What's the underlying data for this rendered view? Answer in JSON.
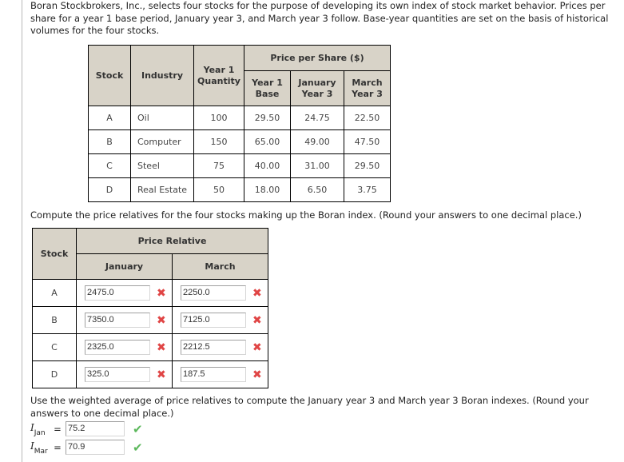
{
  "intro_text": "Boran Stockbrokers, Inc., selects four stocks for the purpose of developing its own index of stock market behavior. Prices per share for a year 1 base period, January year 3, and March year 3 follow. Base-year quantities are set on the basis of historical volumes for the four stocks.",
  "stock_table": {
    "headers": {
      "stock": "Stock",
      "industry": "Industry",
      "quantity_line1": "Year 1",
      "quantity_line2": "Quantity",
      "price_group": "Price per Share ($)",
      "base_line1": "Year 1",
      "base_line2": "Base",
      "jan_line1": "January",
      "jan_line2": "Year 3",
      "mar_line1": "March",
      "mar_line2": "Year 3"
    },
    "rows": [
      {
        "stock": "A",
        "industry": "Oil",
        "quantity": "100",
        "base": "29.50",
        "jan": "24.75",
        "mar": "22.50"
      },
      {
        "stock": "B",
        "industry": "Computer",
        "quantity": "150",
        "base": "65.00",
        "jan": "49.00",
        "mar": "47.50"
      },
      {
        "stock": "C",
        "industry": "Steel",
        "quantity": "75",
        "base": "40.00",
        "jan": "31.00",
        "mar": "29.50"
      },
      {
        "stock": "D",
        "industry": "Real Estate",
        "quantity": "50",
        "base": "18.00",
        "jan": "6.50",
        "mar": "3.75"
      }
    ]
  },
  "question1": "Compute the price relatives for the four stocks making up the Boran index. (Round your answers to one decimal place.)",
  "relative_table": {
    "headers": {
      "stock": "Stock",
      "group": "Price Relative",
      "jan": "January",
      "mar": "March"
    },
    "rows": [
      {
        "stock": "A",
        "jan": "2475.0",
        "jan_status": "incorrect",
        "mar": "2250.0",
        "mar_status": "incorrect"
      },
      {
        "stock": "B",
        "jan": "7350.0",
        "jan_status": "incorrect",
        "mar": "7125.0",
        "mar_status": "incorrect"
      },
      {
        "stock": "C",
        "jan": "2325.0",
        "jan_status": "incorrect",
        "mar": "2212.5",
        "mar_status": "incorrect"
      },
      {
        "stock": "D",
        "jan": "325.0",
        "jan_status": "incorrect",
        "mar": "187.5",
        "mar_status": "incorrect"
      }
    ],
    "incorrect_glyph": "✖"
  },
  "question2": "Use the weighted average of price relatives to compute the January year 3 and March year 3 Boran indexes. (Round your answers to one decimal place.)",
  "indexes": [
    {
      "symbol": "I",
      "subscript": "Jan",
      "equals": "=",
      "value": "75.2",
      "status": "correct"
    },
    {
      "symbol": "I",
      "subscript": "Mar",
      "equals": "=",
      "value": "70.9",
      "status": "correct"
    }
  ],
  "correct_glyph": "✔",
  "colors": {
    "header_bg": "#d8d3c8",
    "incorrect": "#e04545",
    "correct": "#5cb85c"
  }
}
